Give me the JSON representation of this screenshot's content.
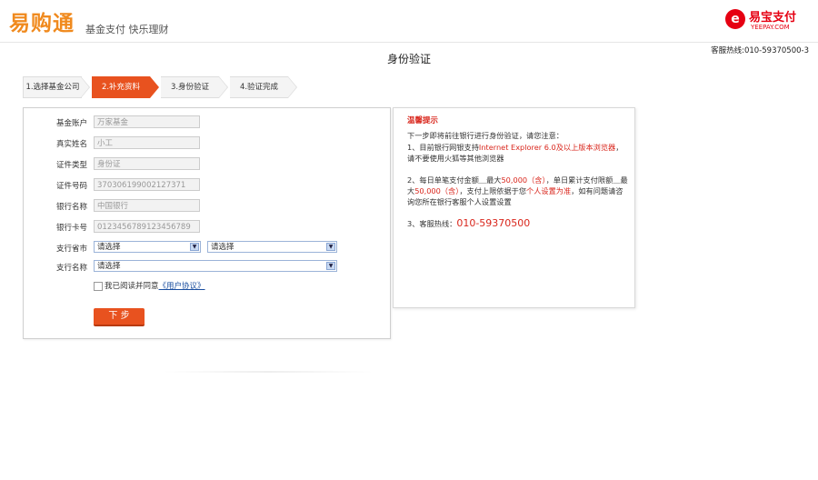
{
  "header": {
    "logo": "易购通",
    "slogan": "基金支付  快乐理财",
    "brand_symbol": "e",
    "brand_name": "易宝支付",
    "brand_url": "YEEPAY.COM"
  },
  "service_phone": "客服热线:010-59370500-3",
  "page_title": "身份验证",
  "steps": [
    {
      "label": "1.选择基金公司",
      "active": false
    },
    {
      "label": "2.补充资料",
      "active": true
    },
    {
      "label": "3.身份验证",
      "active": false
    },
    {
      "label": "4.验证完成",
      "active": false
    }
  ],
  "form": {
    "fund_account": {
      "label": "基金账户",
      "value": "万家基金"
    },
    "real_name": {
      "label": "真实姓名",
      "value": "小工"
    },
    "id_type": {
      "label": "证件类型",
      "value": "身份证"
    },
    "id_number": {
      "label": "证件号码",
      "value": "370306199002127371"
    },
    "bank_name": {
      "label": "银行名称",
      "value": "中国银行"
    },
    "bank_card": {
      "label": "银行卡号",
      "value": "0123456789123456789"
    },
    "branch_region": {
      "label": "支行省市",
      "province_value": "请选择",
      "city_value": "请选择"
    },
    "branch_name": {
      "label": "支行名称",
      "value": "请选择"
    },
    "agreement_text": "我已阅读并同意",
    "agreement_link": "《用户协议》",
    "next_button": "下 步"
  },
  "tips": {
    "title": "温馨提示",
    "intro": "下一步即将前往银行进行身份验证，请您注意：",
    "item1_prefix": "1、目前银行网银支持",
    "item1_highlight": "Internet Explorer 6.0及以上版本浏览器",
    "item1_suffix": "，请不要使用火狐等其他浏览器",
    "item2_a": "2、每日单笔支付金额＿最大",
    "item2_b": "50,000（含）",
    "item2_c": "，单日累计支付限额＿最大",
    "item2_d": "50,000（含）",
    "item2_e": "，支付上限依据于您",
    "item2_f": "个人设置为准",
    "item2_g": "，如有问题请咨询您所在银行客服个人设置设置",
    "hotline_label": "3、客服热线：",
    "hotline": "010-59370500"
  }
}
